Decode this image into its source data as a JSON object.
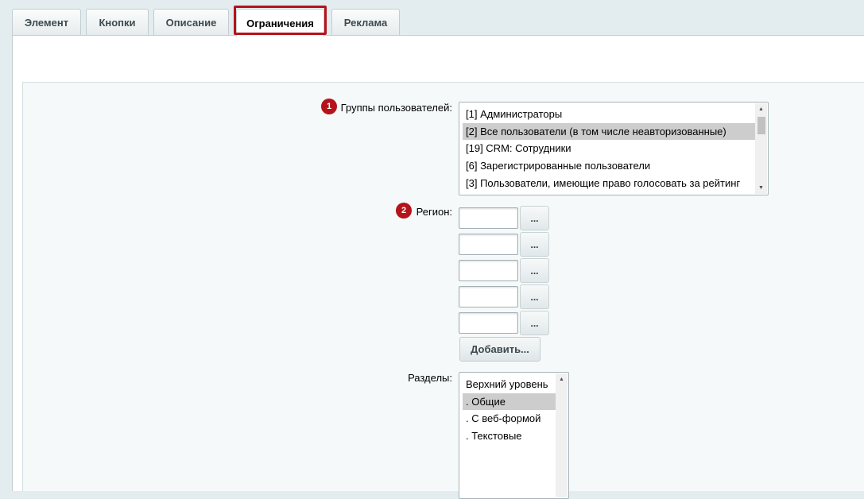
{
  "tabs": [
    {
      "label": "Элемент"
    },
    {
      "label": "Кнопки"
    },
    {
      "label": "Описание"
    },
    {
      "label": "Ограничения",
      "active": true
    },
    {
      "label": "Реклама"
    }
  ],
  "form": {
    "user_groups": {
      "marker": "1",
      "label": "Группы пользователей:",
      "options": [
        "[1] Администраторы",
        "[2] Все пользователи (в том числе неавторизованные)",
        "[19] CRM: Сотрудники",
        "[6] Зарегистрированные пользователи",
        "[3] Пользователи, имеющие право голосовать за рейтинг"
      ],
      "selected_index": 1
    },
    "region": {
      "marker": "2",
      "label": "Регион:",
      "inputs": [
        "",
        "",
        "",
        "",
        ""
      ],
      "browse_label": "...",
      "add_label": "Добавить..."
    },
    "sections": {
      "label": "Разделы:",
      "options": [
        "Верхний уровень",
        ". Общие",
        ". С веб-формой",
        ". Текстовые"
      ],
      "selected_index": 1
    }
  },
  "colors": {
    "accent": "#b5121b",
    "selected_row": "#cdcdcd",
    "background": "#e3ecef"
  }
}
